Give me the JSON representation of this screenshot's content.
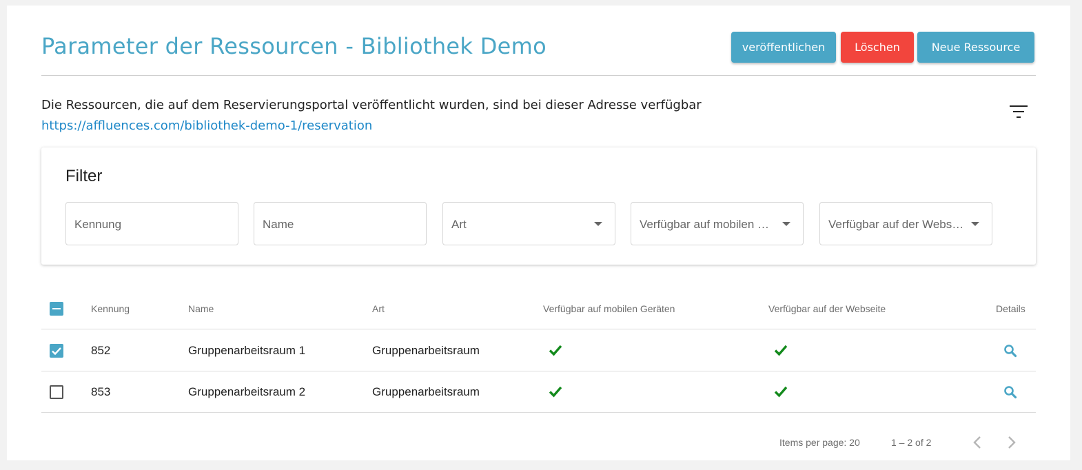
{
  "header": {
    "title": "Parameter der Ressourcen - Bibliothek Demo",
    "publish_label": "veröffentlichen",
    "delete_label": "Löschen",
    "new_label": "Neue Ressource"
  },
  "info": {
    "text": "Die Ressourcen, die auf dem Reservierungsportal veröffentlicht wurden, sind bei dieser Adresse verfügbar",
    "link": "https://affluences.com/bibliothek-demo-1/reservation"
  },
  "filter": {
    "title": "Filter",
    "fields": [
      {
        "placeholder": "Kennung"
      },
      {
        "placeholder": "Name"
      },
      {
        "placeholder": "Art"
      },
      {
        "placeholder": "Verfügbar auf mobilen …"
      },
      {
        "placeholder": "Verfügbar auf der Webs…"
      }
    ]
  },
  "table": {
    "columns": [
      "Kennung",
      "Name",
      "Art",
      "Verfügbar auf mobilen Geräten",
      "Verfügbar auf der Webseite",
      "Details"
    ],
    "rows": [
      {
        "id": "852",
        "name": "Gruppenarbeitsraum 1",
        "type": "Gruppenarbeitsraum",
        "mobile": true,
        "web": true,
        "selected": true
      },
      {
        "id": "853",
        "name": "Gruppenarbeitsraum 2",
        "type": "Gruppenarbeitsraum",
        "mobile": true,
        "web": true,
        "selected": false
      }
    ]
  },
  "pagination": {
    "items_per_page": "Items per page: 20",
    "range": "1 – 2 of 2"
  },
  "colors": {
    "accent": "#4aa6c6",
    "danger": "#f2453d",
    "check": "#138a1c",
    "link": "#1e88c8"
  },
  "icons": [
    "filter-list-icon",
    "dropdown-caret-icon",
    "checkmark-icon",
    "magnifier-icon",
    "chevron-left-icon",
    "chevron-right-icon"
  ]
}
